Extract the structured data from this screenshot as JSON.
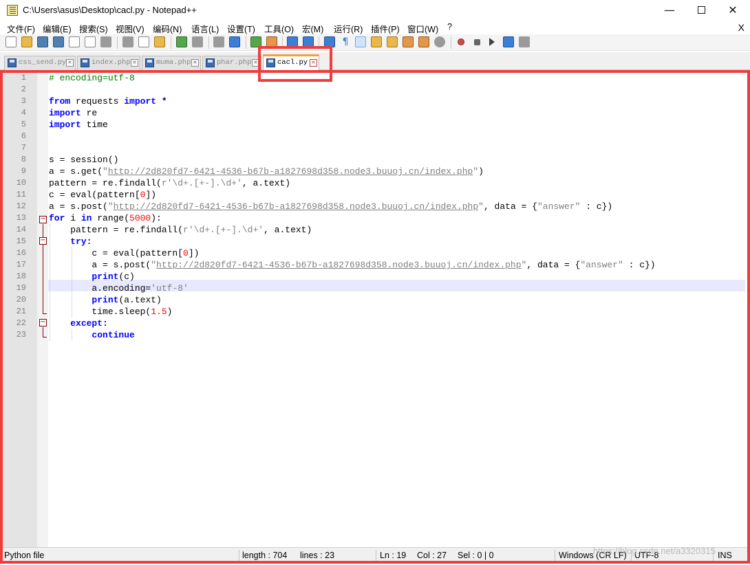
{
  "window": {
    "title": "C:\\Users\\asus\\Desktop\\cacl.py - Notepad++",
    "minimize": "—",
    "close": "✕"
  },
  "menu": [
    "文件(F)",
    "编辑(E)",
    "搜索(S)",
    "视图(V)",
    "编码(N)",
    "语言(L)",
    "设置(T)",
    "工具(O)",
    "宏(M)",
    "运行(R)",
    "插件(P)",
    "窗口(W)",
    "?"
  ],
  "menu_close": "X",
  "tabs": [
    {
      "label": "css_send.py",
      "active": false
    },
    {
      "label": "index.php",
      "active": false
    },
    {
      "label": "muma.php",
      "active": false
    },
    {
      "label": "phar.php",
      "active": false
    },
    {
      "label": "cacl.py",
      "active": true
    }
  ],
  "tab_close_glyph": "✕",
  "editor": {
    "line_numbers": [
      "1",
      "2",
      "3",
      "4",
      "5",
      "6",
      "7",
      "8",
      "9",
      "10",
      "11",
      "12",
      "13",
      "14",
      "15",
      "16",
      "17",
      "18",
      "19",
      "20",
      "21",
      "22",
      "23"
    ],
    "current_line": 19,
    "code_parts": {
      "l1_comment": "# encoding=utf-8",
      "kw_from": "from",
      "kw_import": "import",
      "kw_for": "for",
      "kw_in": "in",
      "kw_try": "try",
      "kw_except": "except",
      "kw_continue": "continue",
      "kw_print": "print",
      "mod_requests": " requests ",
      "star": " *",
      "mod_re": " re",
      "mod_time": " time",
      "l8": "s = session()",
      "l9_a": "a = s.get(",
      "url": "http://2d820fd7-6421-4536-b67b-a1827698d358.node3.buuoj.cn/index.php",
      "quote": "\"",
      "l9_end": ")",
      "l10_a": "pattern = re.findall(",
      "regex": "r'\\d+.[+-].\\d+'",
      "l10_b": ", a.text)",
      "l11_a": "c = eval(pattern[",
      "zero": "0",
      "l11_b": "])",
      "l12_a": "a = s.post(",
      "l12_b": ", data = {",
      "answer": "\"answer\"",
      "l12_c": " : c})",
      "l13_a": " i ",
      "l13_b": " range(",
      "n5000": "5000",
      "l13_c": "):",
      "l14_a": "    pattern = re.findall(",
      "colon": ":",
      "l16_a": "        c = eval(pattern[",
      "l17_a": "        a = s.post(",
      "l18_b": "(c)",
      "l19_a": "        a.encoding=",
      "utf8": "'utf-8'",
      "l20_b": "(a.text)",
      "l21_a": "        time.sleep(",
      "n15": "1.5",
      "l21_b": ")",
      "indent4": "    ",
      "indent8": "        "
    }
  },
  "status": {
    "file_type": "Python file",
    "length": "length : 704",
    "lines": "lines : 23",
    "ln": "Ln : 19",
    "col": "Col : 27",
    "sel": "Sel : 0 | 0",
    "eol": "Windows (CR LF)",
    "encoding": "UTF-8",
    "mode": "INS"
  },
  "watermark": "https://blog.csdn.net/a3320315",
  "colors": {
    "keyword": "#0000ff",
    "string": "#7f7f7f",
    "number": "#ff0000",
    "comment": "#008000",
    "highlight_box": "#f23b3b",
    "active_tab_accent": "#f3a03a"
  }
}
